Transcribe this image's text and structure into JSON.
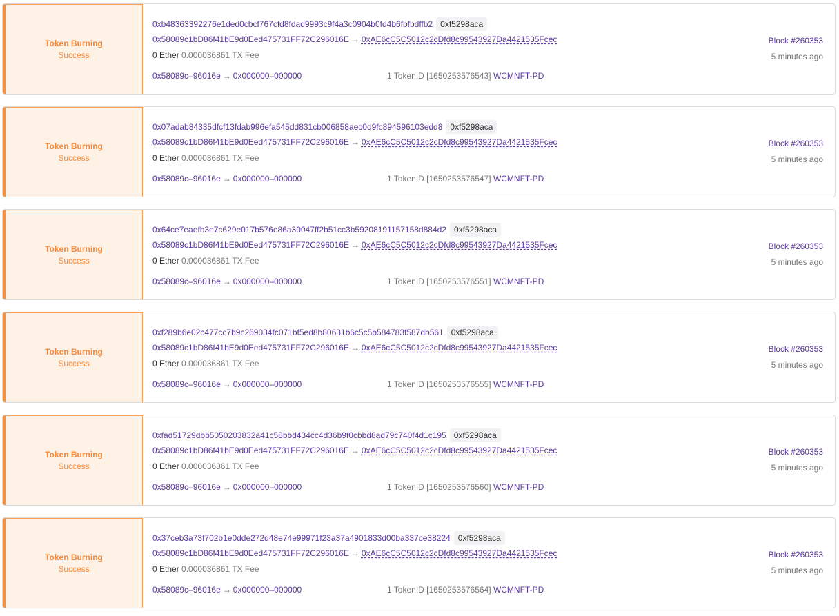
{
  "labels": {
    "arrow": "→",
    "ether": "0 Ether",
    "fee": "0.000036861 TX Fee",
    "token_id_prefix": "1 TokenID [",
    "token_id_suffix": "]",
    "route_from": "0x58089c–96016e",
    "route_to": "0x000000–000000"
  },
  "transactions": [
    {
      "type": "Token Burning",
      "status": "Success",
      "hash": "0xb48363392276e1ded0cbcf767cfd8fdad9993c9f4a3c0904b0fd4b6fbfbdffb2",
      "method": "0xf5298aca",
      "from": "0x58089c1bD86f41bE9d0Eed475731FF72C296016E",
      "to": "0xAE6cC5C5012c2cDfd8c99543927Da4421535Fcec",
      "token_id": "1650253576543",
      "token_name": "WCMNFT-PD",
      "block": "Block #260353",
      "time": "5 minutes ago"
    },
    {
      "type": "Token Burning",
      "status": "Success",
      "hash": "0x07adab84335dfcf13fdab996efa545dd831cb006858aec0d9fc894596103edd8",
      "method": "0xf5298aca",
      "from": "0x58089c1bD86f41bE9d0Eed475731FF72C296016E",
      "to": "0xAE6cC5C5012c2cDfd8c99543927Da4421535Fcec",
      "token_id": "1650253576547",
      "token_name": "WCMNFT-PD",
      "block": "Block #260353",
      "time": "5 minutes ago"
    },
    {
      "type": "Token Burning",
      "status": "Success",
      "hash": "0x64ce7eaefb3e7c629e017b576e86a30047ff2b51cc3b59208191157158d884d2",
      "method": "0xf5298aca",
      "from": "0x58089c1bD86f41bE9d0Eed475731FF72C296016E",
      "to": "0xAE6cC5C5012c2cDfd8c99543927Da4421535Fcec",
      "token_id": "1650253576551",
      "token_name": "WCMNFT-PD",
      "block": "Block #260353",
      "time": "5 minutes ago"
    },
    {
      "type": "Token Burning",
      "status": "Success",
      "hash": "0xf289b6e02c477cc7b9c269034fc071bf5ed8b80631b6c5c5b584783f587db561",
      "method": "0xf5298aca",
      "from": "0x58089c1bD86f41bE9d0Eed475731FF72C296016E",
      "to": "0xAE6cC5C5012c2cDfd8c99543927Da4421535Fcec",
      "token_id": "1650253576555",
      "token_name": "WCMNFT-PD",
      "block": "Block #260353",
      "time": "5 minutes ago"
    },
    {
      "type": "Token Burning",
      "status": "Success",
      "hash": "0xfad51729dbb5050203832a41c58bbd434cc4d36b9f0cbbd8ad79c740f4d1c195",
      "method": "0xf5298aca",
      "from": "0x58089c1bD86f41bE9d0Eed475731FF72C296016E",
      "to": "0xAE6cC5C5012c2cDfd8c99543927Da4421535Fcec",
      "token_id": "1650253576560",
      "token_name": "WCMNFT-PD",
      "block": "Block #260353",
      "time": "5 minutes ago"
    },
    {
      "type": "Token Burning",
      "status": "Success",
      "hash": "0x37ceb3a73f702b1e0dde272d48e74e99971f23a37a4901833d00ba337ce38224",
      "method": "0xf5298aca",
      "from": "0x58089c1bD86f41bE9d0Eed475731FF72C296016E",
      "to": "0xAE6cC5C5012c2cDfd8c99543927Da4421535Fcec",
      "token_id": "1650253576564",
      "token_name": "WCMNFT-PD",
      "block": "Block #260353",
      "time": "5 minutes ago"
    }
  ]
}
